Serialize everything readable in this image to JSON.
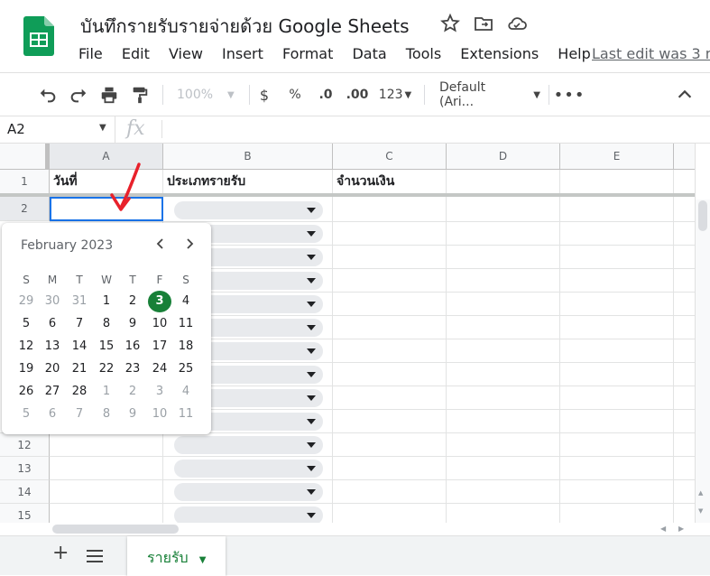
{
  "title": "บันทึกรายรับรายจ่ายด้วย Google Sheets",
  "menu": [
    "File",
    "Edit",
    "View",
    "Insert",
    "Format",
    "Data",
    "Tools",
    "Extensions",
    "Help"
  ],
  "last_edit": "Last edit was 3 m",
  "toolbar": {
    "zoom": "100%",
    "currency": "$",
    "percent": "%",
    "dec_less": ".0",
    "dec_more": ".00",
    "format_more": "123",
    "font": "Default (Ari..."
  },
  "name_box": "A2",
  "fx": "fx",
  "columns": [
    "A",
    "B",
    "C",
    "D",
    "E"
  ],
  "rows": [
    "1",
    "2",
    "12",
    "13",
    "14",
    "15"
  ],
  "header_cells": {
    "a1": "วันที่",
    "b1": "ประเภทรายรับ",
    "c1": "จำนวนเงิน"
  },
  "datepicker": {
    "month": "February 2023",
    "weekdays": [
      "S",
      "M",
      "T",
      "W",
      "T",
      "F",
      "S"
    ],
    "weeks": [
      [
        "29",
        "30",
        "31",
        "1",
        "2",
        "3",
        "4"
      ],
      [
        "5",
        "6",
        "7",
        "8",
        "9",
        "10",
        "11"
      ],
      [
        "12",
        "13",
        "14",
        "15",
        "16",
        "17",
        "18"
      ],
      [
        "19",
        "20",
        "21",
        "22",
        "23",
        "24",
        "25"
      ],
      [
        "26",
        "27",
        "28",
        "1",
        "2",
        "3",
        "4"
      ],
      [
        "5",
        "6",
        "7",
        "8",
        "9",
        "10",
        "11"
      ]
    ],
    "selected": "3"
  },
  "sheet_tab": "รายรับ",
  "colors": {
    "accent": "#188038",
    "selection": "#1a73e8",
    "annotation": "#e8212b"
  }
}
